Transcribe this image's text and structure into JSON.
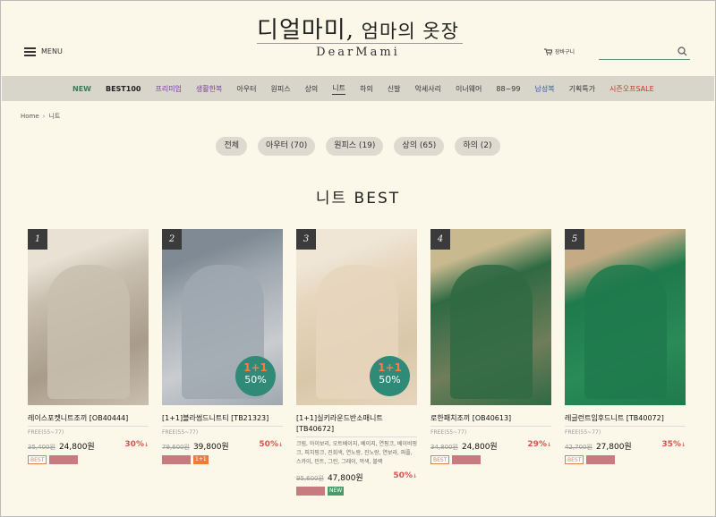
{
  "header": {
    "logo_main": "디얼마미,",
    "logo_sub": " 엄마의 옷장",
    "logo_en": "DearMami",
    "menu_label": "MENU",
    "cart_label": "장바구니",
    "search_placeholder": ""
  },
  "nav": [
    {
      "label": "NEW",
      "style": "new"
    },
    {
      "label": "BEST100",
      "style": "best"
    },
    {
      "label": "프리미엄",
      "style": "purple"
    },
    {
      "label": "생활한복",
      "style": "purple"
    },
    {
      "label": "아우터",
      "style": ""
    },
    {
      "label": "원피스",
      "style": ""
    },
    {
      "label": "상의",
      "style": ""
    },
    {
      "label": "니트",
      "style": "active"
    },
    {
      "label": "하의",
      "style": ""
    },
    {
      "label": "신발",
      "style": ""
    },
    {
      "label": "악세사리",
      "style": ""
    },
    {
      "label": "이너웨어",
      "style": ""
    },
    {
      "label": "88~99",
      "style": ""
    },
    {
      "label": "남성복",
      "style": "blue"
    },
    {
      "label": "기획특가",
      "style": ""
    },
    {
      "label": "시즌오프SALE",
      "style": "red"
    }
  ],
  "breadcrumb": {
    "home": "Home",
    "current": "니트"
  },
  "filters": [
    "전체",
    "아우터 (70)",
    "원피스 (19)",
    "상의 (65)",
    "하의 (2)"
  ],
  "section_title": "니트 BEST",
  "products": [
    {
      "rank": "1",
      "name": "레이스포켓니트조끼 [OB40444]",
      "size": "FREE(55~77)",
      "desc": "",
      "orig": "35,400원",
      "price": "24,800원",
      "disc": "30%",
      "tags": [
        "best",
        "pink"
      ],
      "promo": false,
      "colors": [
        "#c9bfb0",
        "#a89b89",
        "#e8e1d4"
      ]
    },
    {
      "rank": "2",
      "name": "[1+1]블라썸드니트티 [TB21323]",
      "size": "FREE(55~77)",
      "desc": "",
      "orig": "79,600원",
      "price": "39,800원",
      "disc": "50%",
      "tags": [
        "pink",
        "1+1"
      ],
      "promo": true,
      "colors": [
        "#9fa8b0",
        "#c9ccd0",
        "#7f8a94"
      ]
    },
    {
      "rank": "3",
      "name": "[1+1]실키라운드반소매니트 [TB40672]",
      "size": "",
      "desc": "크림, 아이보리, 오트베이지, 베이지, 연핑크, 베이비핑크, 피치핑크, 진회색, 연노랑, 진노랑, 연보라, 퍼플, 스카이, 민트, 그린, 그레이, 먹색, 블랙",
      "orig": "95,600원",
      "price": "47,800원",
      "disc": "50%",
      "tags": [
        "pink",
        "new"
      ],
      "promo": true,
      "colors": [
        "#e6d6bd",
        "#d9c7a8",
        "#efe6d6"
      ]
    },
    {
      "rank": "4",
      "name": "로한패치조끼 [OB40613]",
      "size": "FREE(55~77)",
      "desc": "",
      "orig": "34,800원",
      "price": "24,800원",
      "disc": "29%",
      "tags": [
        "best",
        "pink"
      ],
      "promo": false,
      "colors": [
        "#2f6a43",
        "#6f7d5a",
        "#c9b98f"
      ]
    },
    {
      "rank": "5",
      "name": "레글런트임후드니트 [TB40072]",
      "size": "FREE(55~77)",
      "desc": "",
      "orig": "42,700원",
      "price": "27,800원",
      "disc": "35%",
      "tags": [
        "best",
        "pink"
      ],
      "promo": false,
      "colors": [
        "#1f7a4c",
        "#2a8a58",
        "#c4ab85"
      ]
    }
  ],
  "tag_labels": {
    "best": "BEST",
    "1+1": "1+1",
    "new": "NEW",
    "pink": ""
  },
  "promo_badge": {
    "top": "1+1",
    "pct": "50%"
  },
  "disc_suffix": "↓"
}
